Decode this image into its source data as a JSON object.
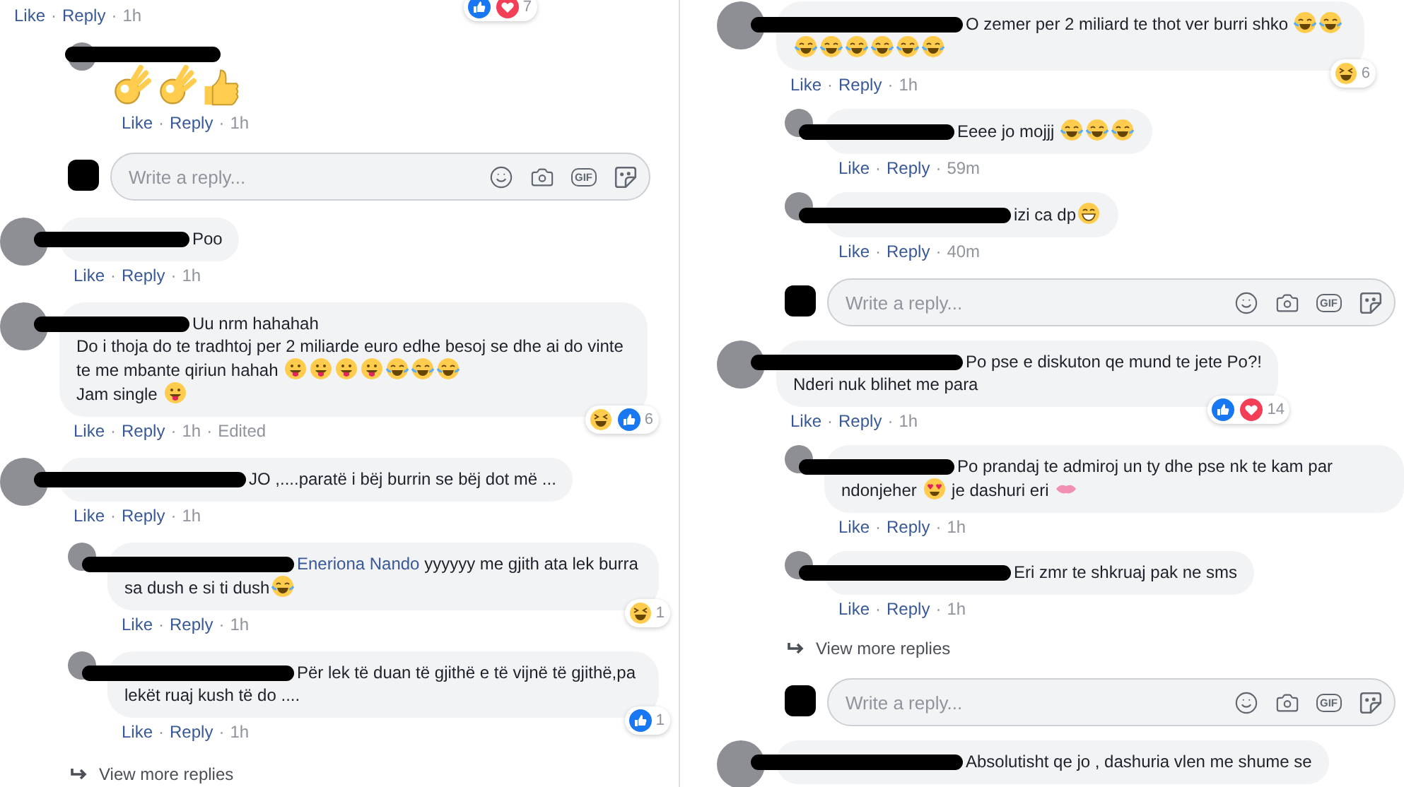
{
  "columns": [
    {
      "items": [
        {
          "kind": "meta",
          "meta": [
            {
              "kind": "link",
              "text": "Like"
            },
            {
              "kind": "sep",
              "text": "·"
            },
            {
              "kind": "link",
              "text": "Reply"
            },
            {
              "kind": "sep",
              "text": "·"
            },
            {
              "kind": "time",
              "text": "1h"
            }
          ],
          "reactions": {
            "icons": [
              {
                "kind": "like"
              },
              {
                "kind": "love"
              }
            ],
            "count": "7"
          }
        },
        {
          "kind": "emoji-reply",
          "avatar": {
            "kind": "photo"
          },
          "redaction": {
            "kind": "long"
          },
          "body": [
            {
              "kind": "ok-hand"
            },
            {
              "kind": "ok-hand"
            },
            {
              "kind": "thumbs-up"
            }
          ],
          "meta": [
            {
              "kind": "link",
              "text": "Like"
            },
            {
              "kind": "sep",
              "text": "·"
            },
            {
              "kind": "link",
              "text": "Reply"
            },
            {
              "kind": "sep",
              "text": "·"
            },
            {
              "kind": "time",
              "text": "1h"
            }
          ]
        },
        {
          "kind": "reply-box",
          "avatar": {
            "kind": "redacted"
          },
          "placeholder": "Write a reply...",
          "gif": "GIF"
        },
        {
          "kind": "comment",
          "avatar": {
            "kind": "photo"
          },
          "redaction": {
            "kind": "long"
          },
          "body": [
            {
              "kind": "text",
              "text": "Poo"
            }
          ],
          "meta": [
            {
              "kind": "link",
              "text": "Like"
            },
            {
              "kind": "sep",
              "text": "·"
            },
            {
              "kind": "link",
              "text": "Reply"
            },
            {
              "kind": "sep",
              "text": "·"
            },
            {
              "kind": "time",
              "text": "1h"
            }
          ]
        },
        {
          "kind": "comment",
          "avatar": {
            "kind": "photo"
          },
          "redaction": {
            "kind": "long"
          },
          "body": [
            {
              "kind": "text",
              "text": "Uu nrm hahahah"
            },
            {
              "kind": "br"
            },
            {
              "kind": "text",
              "text": "Do i thoja do te tradhtoj per 2 miliarde euro edhe besoj se dhe ai do vinte te me mbante qiriun hahah "
            },
            {
              "kind": "tongue"
            },
            {
              "kind": "tongue"
            },
            {
              "kind": "tongue"
            },
            {
              "kind": "tongue"
            },
            {
              "kind": "joy"
            },
            {
              "kind": "joy"
            },
            {
              "kind": "joy"
            },
            {
              "kind": "br"
            },
            {
              "kind": "text",
              "text": "Jam single "
            },
            {
              "kind": "tongue"
            }
          ],
          "meta": [
            {
              "kind": "link",
              "text": "Like"
            },
            {
              "kind": "sep",
              "text": "·"
            },
            {
              "kind": "link",
              "text": "Reply"
            },
            {
              "kind": "sep",
              "text": "·"
            },
            {
              "kind": "time",
              "text": "1h"
            },
            {
              "kind": "sep",
              "text": "·"
            },
            {
              "kind": "edited",
              "text": "Edited"
            }
          ],
          "reactions": {
            "icons": [
              {
                "kind": "haha"
              },
              {
                "kind": "like"
              }
            ],
            "count": "6"
          }
        },
        {
          "kind": "comment",
          "avatar": {
            "kind": "photo"
          },
          "redaction": {
            "kind": "wide"
          },
          "body": [
            {
              "kind": "text",
              "text": "JO ,....paratë i bëj burrin se bëj dot më ..."
            }
          ],
          "meta": [
            {
              "kind": "link",
              "text": "Like"
            },
            {
              "kind": "sep",
              "text": "·"
            },
            {
              "kind": "link",
              "text": "Reply"
            },
            {
              "kind": "sep",
              "text": "·"
            },
            {
              "kind": "time",
              "text": "1h"
            }
          ]
        },
        {
          "kind": "reply",
          "avatar": {
            "kind": "photo"
          },
          "redaction": {
            "kind": "wide"
          },
          "body": [
            {
              "kind": "mention",
              "text": "Eneriona Nando"
            },
            {
              "kind": "text",
              "text": " yyyyyy me gjith ata lek burra sa dush e si ti dush"
            },
            {
              "kind": "joy"
            }
          ],
          "meta": [
            {
              "kind": "link",
              "text": "Like"
            },
            {
              "kind": "sep",
              "text": "·"
            },
            {
              "kind": "link",
              "text": "Reply"
            },
            {
              "kind": "sep",
              "text": "·"
            },
            {
              "kind": "time",
              "text": "1h"
            }
          ],
          "reactions": {
            "icons": [
              {
                "kind": "haha"
              }
            ],
            "count": "1"
          }
        },
        {
          "kind": "reply",
          "avatar": {
            "kind": "photo"
          },
          "redaction": {
            "kind": "wide"
          },
          "body": [
            {
              "kind": "text",
              "text": "Për lek të duan të gjithë e të vijnë të gjithë,pa lekët ruaj kush të do ...."
            }
          ],
          "meta": [
            {
              "kind": "link",
              "text": "Like"
            },
            {
              "kind": "sep",
              "text": "·"
            },
            {
              "kind": "link",
              "text": "Reply"
            },
            {
              "kind": "sep",
              "text": "·"
            },
            {
              "kind": "time",
              "text": "1h"
            }
          ],
          "reactions": {
            "icons": [
              {
                "kind": "like"
              }
            ],
            "count": "1"
          }
        },
        {
          "kind": "more",
          "text": "View more replies"
        }
      ]
    },
    {
      "items": [
        {
          "kind": "comment",
          "avatar": {
            "kind": "photo"
          },
          "redaction": {
            "kind": "wide"
          },
          "body": [
            {
              "kind": "text",
              "text": "O zemer per 2 miliard te thot ver burri shko "
            },
            {
              "kind": "joy"
            },
            {
              "kind": "joy"
            },
            {
              "kind": "joy"
            },
            {
              "kind": "joy"
            },
            {
              "kind": "joy"
            },
            {
              "kind": "joy"
            },
            {
              "kind": "joy"
            },
            {
              "kind": "joy"
            }
          ],
          "meta": [
            {
              "kind": "link",
              "text": "Like"
            },
            {
              "kind": "sep",
              "text": "·"
            },
            {
              "kind": "link",
              "text": "Reply"
            },
            {
              "kind": "sep",
              "text": "·"
            },
            {
              "kind": "time",
              "text": "1h"
            }
          ],
          "reactions": {
            "icons": [
              {
                "kind": "haha"
              }
            ],
            "count": "6"
          }
        },
        {
          "kind": "reply",
          "avatar": {
            "kind": "photo"
          },
          "redaction": {
            "kind": "long"
          },
          "body": [
            {
              "kind": "text",
              "text": "Eeee jo mojjj "
            },
            {
              "kind": "joy"
            },
            {
              "kind": "joy"
            },
            {
              "kind": "joy"
            }
          ],
          "meta": [
            {
              "kind": "link",
              "text": "Like"
            },
            {
              "kind": "sep",
              "text": "·"
            },
            {
              "kind": "link",
              "text": "Reply"
            },
            {
              "kind": "sep",
              "text": "·"
            },
            {
              "kind": "time",
              "text": "59m"
            }
          ]
        },
        {
          "kind": "reply",
          "avatar": {
            "kind": "photo"
          },
          "redaction": {
            "kind": "wide"
          },
          "body": [
            {
              "kind": "text",
              "text": "izi ca dp"
            },
            {
              "kind": "grin"
            }
          ],
          "meta": [
            {
              "kind": "link",
              "text": "Like"
            },
            {
              "kind": "sep",
              "text": "·"
            },
            {
              "kind": "link",
              "text": "Reply"
            },
            {
              "kind": "sep",
              "text": "·"
            },
            {
              "kind": "time",
              "text": "40m"
            }
          ]
        },
        {
          "kind": "reply-box",
          "avatar": {
            "kind": "redacted"
          },
          "placeholder": "Write a reply...",
          "gif": "GIF"
        },
        {
          "kind": "comment",
          "avatar": {
            "kind": "photo"
          },
          "redaction": {
            "kind": "wide"
          },
          "body": [
            {
              "kind": "text",
              "text": "Po pse e diskuton qe mund te jete Po?!"
            },
            {
              "kind": "br"
            },
            {
              "kind": "text",
              "text": "Nderi nuk blihet me para"
            }
          ],
          "meta": [
            {
              "kind": "link",
              "text": "Like"
            },
            {
              "kind": "sep",
              "text": "·"
            },
            {
              "kind": "link",
              "text": "Reply"
            },
            {
              "kind": "sep",
              "text": "·"
            },
            {
              "kind": "time",
              "text": "1h"
            }
          ],
          "reactions": {
            "icons": [
              {
                "kind": "like"
              },
              {
                "kind": "love"
              }
            ],
            "count": "14"
          }
        },
        {
          "kind": "reply",
          "avatar": {
            "kind": "photo"
          },
          "redaction": {
            "kind": "long"
          },
          "body": [
            {
              "kind": "text",
              "text": "Po prandaj te admiroj un ty dhe pse nk te kam par ndonjeher "
            },
            {
              "kind": "heart-eyes"
            },
            {
              "kind": "text",
              "text": " je dashuri eri "
            },
            {
              "kind": "kiss"
            }
          ],
          "meta": [
            {
              "kind": "link",
              "text": "Like"
            },
            {
              "kind": "sep",
              "text": "·"
            },
            {
              "kind": "link",
              "text": "Reply"
            },
            {
              "kind": "sep",
              "text": "·"
            },
            {
              "kind": "time",
              "text": "1h"
            }
          ]
        },
        {
          "kind": "reply",
          "avatar": {
            "kind": "photo"
          },
          "redaction": {
            "kind": "wide"
          },
          "body": [
            {
              "kind": "text",
              "text": "Eri zmr te shkruaj pak ne sms"
            }
          ],
          "meta": [
            {
              "kind": "link",
              "text": "Like"
            },
            {
              "kind": "sep",
              "text": "·"
            },
            {
              "kind": "link",
              "text": "Reply"
            },
            {
              "kind": "sep",
              "text": "·"
            },
            {
              "kind": "time",
              "text": "1h"
            }
          ]
        },
        {
          "kind": "more",
          "text": "View more replies"
        },
        {
          "kind": "reply-box",
          "avatar": {
            "kind": "redacted"
          },
          "placeholder": "Write a reply...",
          "gif": "GIF"
        },
        {
          "kind": "comment",
          "avatar": {
            "kind": "photo"
          },
          "redaction": {
            "kind": "wide"
          },
          "body": [
            {
              "kind": "text",
              "text": "Absolutisht qe jo , dashuria vlen me shume se"
            }
          ]
        }
      ]
    }
  ]
}
